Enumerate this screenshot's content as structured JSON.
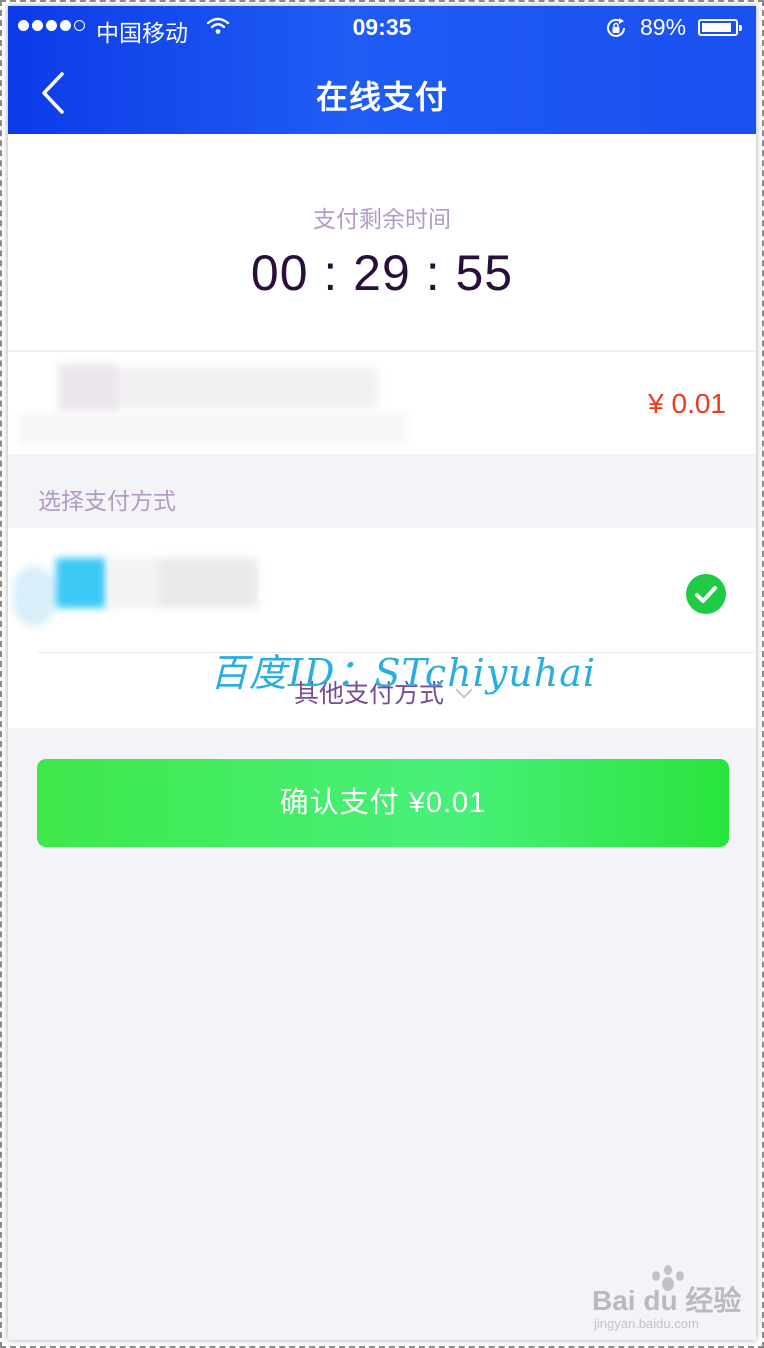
{
  "status_bar": {
    "carrier": "中国移动",
    "time": "09:35",
    "battery_percent": "89%",
    "battery_level": 0.89,
    "signal_bars": 4,
    "icons": [
      "signal-dots-icon",
      "wifi-icon",
      "rotation-lock-icon",
      "battery-icon"
    ]
  },
  "nav": {
    "title": "在线支付",
    "back_icon": "chevron-left-icon"
  },
  "timer": {
    "label": "支付剩余时间",
    "value": "00 : 29 : 55"
  },
  "order": {
    "price": "¥ 0.01"
  },
  "payment": {
    "section_label": "选择支付方式",
    "selected_icon": "check-circle-icon",
    "other_label": "其他支付方式"
  },
  "confirm": {
    "label": "确认支付 ¥0.01"
  },
  "watermark": {
    "text": "百度ID：STchiyuhai",
    "logo_text": "Bai du 经验",
    "logo_url_text": "jingyan.baidu.com"
  },
  "colors": {
    "header": "#1f5cf4",
    "price": "#ee3a1a",
    "confirm_button": "#3ee84a",
    "check": "#1fcb45",
    "watermark": "#2aaee2"
  }
}
